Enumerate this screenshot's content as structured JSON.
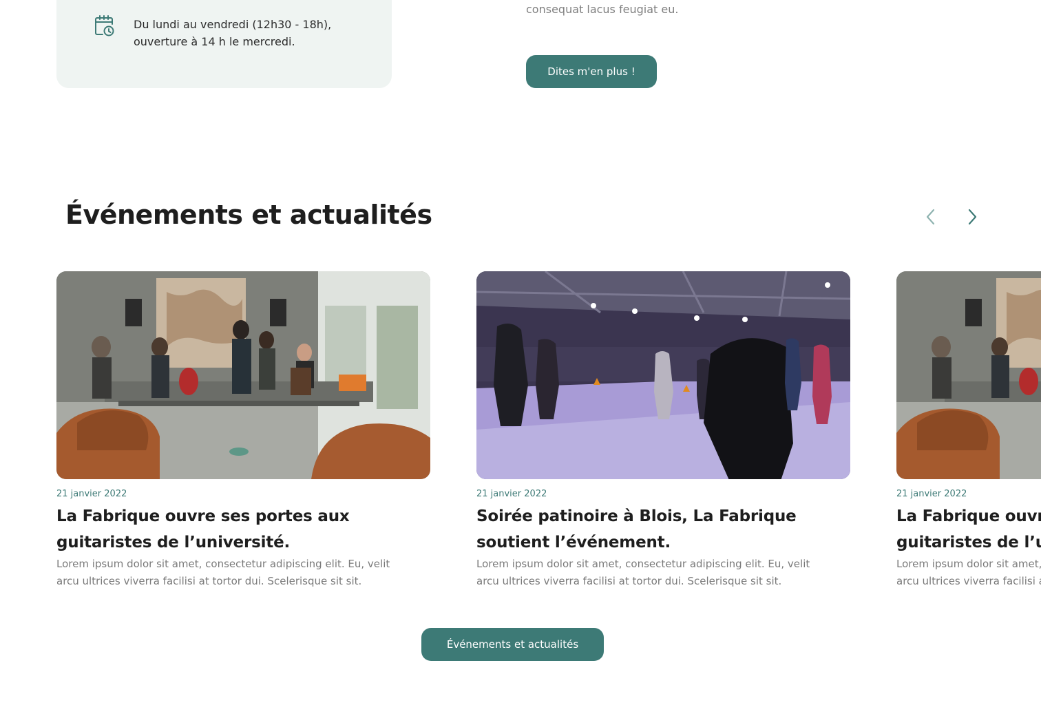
{
  "info": {
    "hours_line1": "Du lundi au vendredi (12h30 - 18h),",
    "hours_line2": "ouverture à 14 h le mercredi.",
    "icon": "calendar-clock-icon"
  },
  "intro": {
    "text_tail": "consequat lacus feugiat eu.",
    "more_button": "Dites m'en plus !"
  },
  "events": {
    "title": "Événements et actualités",
    "prev_icon": "chevron-left-icon",
    "next_icon": "chevron-right-icon",
    "all_button": "Événements et actualités",
    "cards": [
      {
        "date": "21 janvier 2022",
        "title_line1": "La Fabrique ouvre ses portes aux",
        "title_line2": "guitaristes de l’université.",
        "desc_line1": "Lorem ipsum dolor sit amet, consectetur adipiscing elit. Eu, velit",
        "desc_line2": "arcu ultrices viverra facilisi at tortor dui. Scelerisque sit sit.",
        "image": "concert-photo"
      },
      {
        "date": "21 janvier 2022",
        "title_line1": "Soirée patinoire à Blois, La Fabrique",
        "title_line2": "soutient l’événement.",
        "desc_line1": "Lorem ipsum dolor sit amet, consectetur adipiscing elit. Eu, velit",
        "desc_line2": "arcu ultrices viverra facilisi at tortor dui. Scelerisque sit sit.",
        "image": "ice-rink-photo"
      },
      {
        "date": "21 janvier 2022",
        "title_line1": "La Fabrique ouvre ses portes aux",
        "title_line2": "guitaristes de l’université.",
        "desc_line1": "Lorem ipsum dolor sit amet, consectetur adipiscing elit. Eu, velit",
        "desc_line2": "arcu ultrices viverra facilisi at tortor dui. Scelerisque sit sit.",
        "image": "concert-photo"
      }
    ]
  },
  "colors": {
    "accent": "#3d7a76",
    "card_bg": "#eff4f2"
  }
}
